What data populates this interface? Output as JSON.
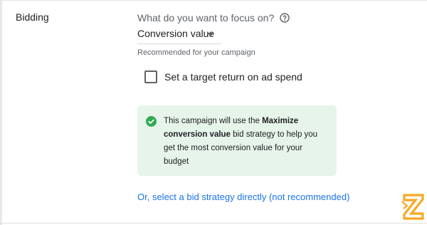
{
  "bidding": {
    "section_title": "Bidding",
    "focus_question": "What do you want to focus on?",
    "focus_value": "Conversion value",
    "recommendation": "Recommended for your campaign",
    "target_roas_label": "Set a target return on ad spend",
    "target_roas_checked": false,
    "info": {
      "text_before": "This campaign will use the ",
      "strategy_name": "Maximize conversion value",
      "text_after": " bid strategy to help you get the most conversion value for your budget"
    },
    "select_strategy_link": "Or, select a bid strategy directly (not recommended)"
  },
  "colors": {
    "info_background": "#e6f4ea",
    "success_green": "#34a853",
    "link_blue": "#1a73e8",
    "brand_orange": "#f9a825"
  },
  "icons": {
    "help": "help-circle-icon",
    "dropdown": "caret-down-icon",
    "success": "check-circle-icon",
    "logo": "brand-z-icon"
  }
}
